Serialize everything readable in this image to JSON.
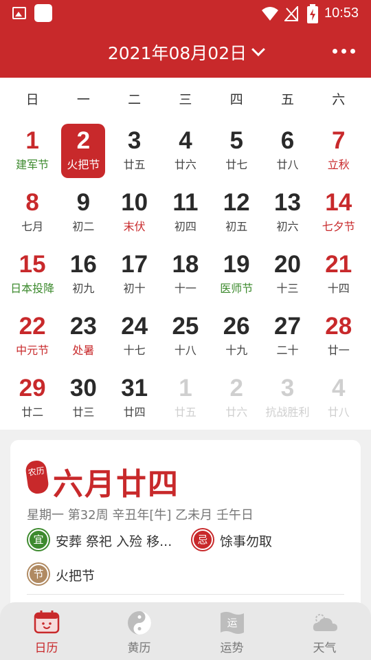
{
  "status_bar": {
    "time": "10:53"
  },
  "header": {
    "title": "2021年08月02日"
  },
  "weekdays": [
    "日",
    "一",
    "二",
    "三",
    "四",
    "五",
    "六"
  ],
  "weeks": [
    [
      {
        "day": "1",
        "sub": "建军节"
      },
      {
        "day": "2",
        "sub": "火把节"
      },
      {
        "day": "3",
        "sub": "廿五"
      },
      {
        "day": "4",
        "sub": "廿六"
      },
      {
        "day": "5",
        "sub": "廿七"
      },
      {
        "day": "6",
        "sub": "廿八"
      },
      {
        "day": "7",
        "sub": "立秋"
      }
    ],
    [
      {
        "day": "8",
        "sub": "七月"
      },
      {
        "day": "9",
        "sub": "初二"
      },
      {
        "day": "10",
        "sub": "末伏"
      },
      {
        "day": "11",
        "sub": "初四"
      },
      {
        "day": "12",
        "sub": "初五"
      },
      {
        "day": "13",
        "sub": "初六"
      },
      {
        "day": "14",
        "sub": "七夕节"
      }
    ],
    [
      {
        "day": "15",
        "sub": "日本投降"
      },
      {
        "day": "16",
        "sub": "初九"
      },
      {
        "day": "17",
        "sub": "初十"
      },
      {
        "day": "18",
        "sub": "十一"
      },
      {
        "day": "19",
        "sub": "医师节"
      },
      {
        "day": "20",
        "sub": "十三"
      },
      {
        "day": "21",
        "sub": "十四"
      }
    ],
    [
      {
        "day": "22",
        "sub": "中元节"
      },
      {
        "day": "23",
        "sub": "处暑"
      },
      {
        "day": "24",
        "sub": "十七"
      },
      {
        "day": "25",
        "sub": "十八"
      },
      {
        "day": "26",
        "sub": "十九"
      },
      {
        "day": "27",
        "sub": "二十"
      },
      {
        "day": "28",
        "sub": "廿一"
      }
    ],
    [
      {
        "day": "29",
        "sub": "廿二"
      },
      {
        "day": "30",
        "sub": "廿三"
      },
      {
        "day": "31",
        "sub": "廿四"
      },
      {
        "day": "1",
        "sub": "廿五"
      },
      {
        "day": "2",
        "sub": "廿六"
      },
      {
        "day": "3",
        "sub": "抗战胜利"
      },
      {
        "day": "4",
        "sub": "廿八"
      }
    ]
  ],
  "detail": {
    "seal_text": "农历",
    "lunar_date": "六月廿四",
    "info": "星期一 第32周 辛丑年[牛] 乙未月 壬午日",
    "yi_label": "宜",
    "yi_text": "安葬 祭祀 入殓 移...",
    "ji_label": "忌",
    "ji_text": "馀事勿取",
    "jie_label": "节",
    "jie_text": "火把节"
  },
  "nav": [
    {
      "label": "日历",
      "icon": "calendar-icon"
    },
    {
      "label": "黄历",
      "icon": "yin-yang-icon"
    },
    {
      "label": "运势",
      "icon": "fortune-flag-icon"
    },
    {
      "label": "天气",
      "icon": "cloud-icon"
    }
  ],
  "colors": {
    "accent": "#c8292b",
    "green": "#3d8a2e",
    "festival_badge": "#b08a62"
  }
}
